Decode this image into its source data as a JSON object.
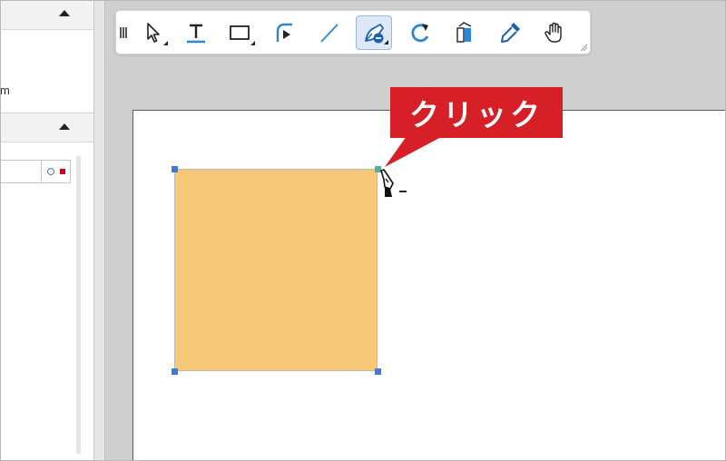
{
  "left_panel": {
    "unit_text": "m"
  },
  "toolbar": {
    "tools": [
      {
        "name": "select-tool",
        "icon": "arrow-cursor-icon",
        "active": false
      },
      {
        "name": "text-tool",
        "icon": "text-icon",
        "active": false
      },
      {
        "name": "rectangle-tool",
        "icon": "rectangle-icon",
        "active": false
      },
      {
        "name": "corner-tool",
        "icon": "rounded-corner-icon",
        "active": false
      },
      {
        "name": "line-tool",
        "icon": "line-icon",
        "active": false
      },
      {
        "name": "pen-tool",
        "icon": "pen-minus-icon",
        "active": true
      },
      {
        "name": "rotate-tool",
        "icon": "rotate-icon",
        "active": false
      },
      {
        "name": "gradient-tool",
        "icon": "gradient-icon",
        "active": false
      },
      {
        "name": "eyedropper-tool",
        "icon": "eyedropper-icon",
        "active": false
      },
      {
        "name": "hand-tool",
        "icon": "hand-icon",
        "active": false
      }
    ]
  },
  "canvas": {
    "shape_fill": "#f7c878",
    "handle_color": "#3d7ae0",
    "selected_handle_color": "#4fae9f"
  },
  "callout": {
    "text": "クリック",
    "color": "#d61f26"
  }
}
